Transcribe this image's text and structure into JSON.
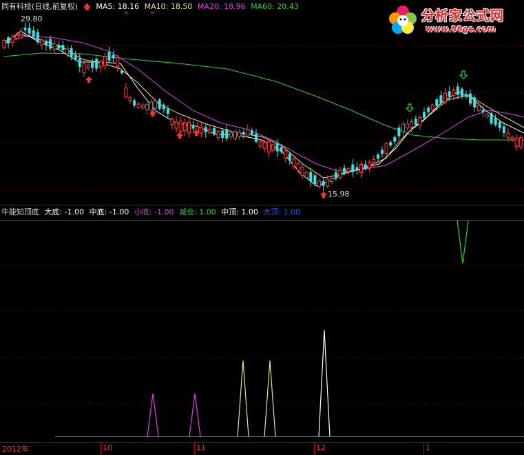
{
  "top_header": {
    "stock": "同有科技(日线,前复权)",
    "ma5": "MA5: 18.16",
    "ma10": "MA10: 18.50",
    "ma20": "MA20: 18.96",
    "ma60": "MA60: 20.43"
  },
  "price_labels": {
    "high": "29.80",
    "low": "15.98"
  },
  "indicator_header": {
    "name": "牛能知顶底",
    "da_di": "大底: -1.00",
    "zhong_di": "中底: -1.00",
    "xiao_di": "小底: -1.00",
    "jian_cang": "减仓: 1.00",
    "zhong_ding": "中顶: 1.00",
    "da_ding": "大顶: 1.00"
  },
  "watermark": {
    "title": "分析家公式网",
    "url": "www.88gs.com"
  },
  "x_axis": {
    "labels": [
      "2012年",
      "10",
      "11",
      "12",
      "1"
    ]
  },
  "colors": {
    "ma5": "#ffffff",
    "ma10": "#f0e68c",
    "ma20": "#e040e0",
    "ma60": "#30d030",
    "up": "#ff4040",
    "down": "#40e0e0",
    "signal_small_bottom": "#e040e0",
    "signal_mid_bottom": "#f0e68c",
    "signal_big_bottom": "#ffffff",
    "signal_reduce": "#30d030",
    "grid": "#8b0000"
  }
}
